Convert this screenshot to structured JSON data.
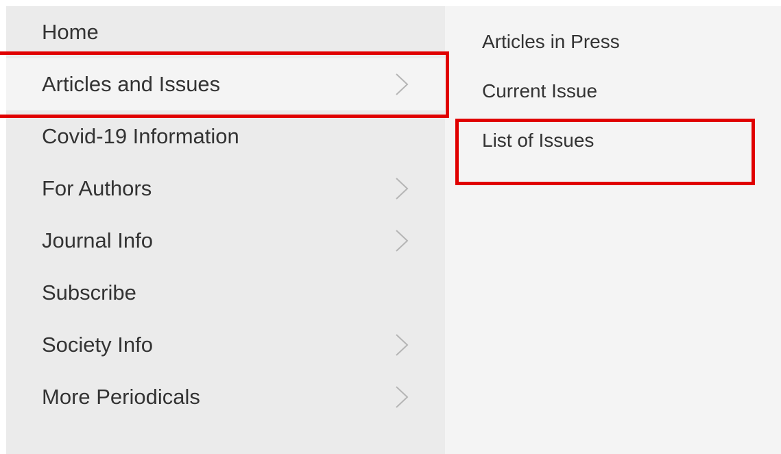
{
  "main_menu": {
    "items": [
      {
        "label": "Home",
        "has_submenu": false
      },
      {
        "label": "Articles and Issues",
        "has_submenu": true,
        "active": true
      },
      {
        "label": "Covid-19 Information",
        "has_submenu": false
      },
      {
        "label": "For Authors",
        "has_submenu": true
      },
      {
        "label": "Journal Info",
        "has_submenu": true
      },
      {
        "label": "Subscribe",
        "has_submenu": false
      },
      {
        "label": "Society Info",
        "has_submenu": true
      },
      {
        "label": "More Periodicals",
        "has_submenu": true
      }
    ]
  },
  "submenu": {
    "items": [
      {
        "label": "Articles in Press"
      },
      {
        "label": "Current Issue"
      },
      {
        "label": "List of Issues"
      }
    ]
  },
  "colors": {
    "left_panel_bg": "#ebebeb",
    "right_panel_bg": "#f4f4f4",
    "active_item_bg": "#f4f4f4",
    "text": "#333333",
    "chevron": "#b5b5b5",
    "highlight_border": "#e00000"
  },
  "icons": {
    "submenu_indicator": "chevron-right-icon"
  }
}
